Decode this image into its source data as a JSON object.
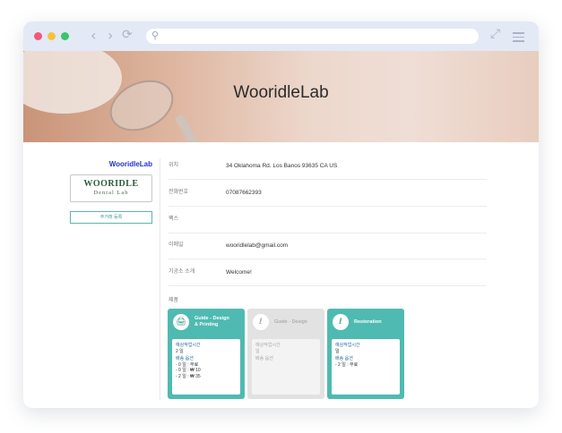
{
  "browser": {
    "back_icon": "‹",
    "forward_icon": "›",
    "reload_icon": "⟳",
    "search_icon": "⚲",
    "expand_icon": "⤢"
  },
  "banner": {
    "title": "WooridleLab"
  },
  "sidebar": {
    "lab_name": "WooridleLab",
    "logo_line1": "WOORIDLE",
    "logo_line2": "Dental Lab",
    "add_button": "주거래 등록"
  },
  "info": [
    {
      "label": "위치",
      "value": "34 Oklahoma Rd. Los Banos 93635 CA US"
    },
    {
      "label": "전화번호",
      "value": "07087662393"
    },
    {
      "label": "팩스",
      "value": ""
    },
    {
      "label": "이메일",
      "value": "wooridlelab@gmail.com"
    },
    {
      "label": "기공소 소개",
      "value": "Welcome!"
    }
  ],
  "products_label": "제품",
  "cards": [
    {
      "icon": "🖨",
      "title1": "Guide - Design",
      "title2": "& Printing",
      "time_label": "예상작업시간",
      "time_value": "2 일",
      "ship_label": "배송 옵션",
      "ship_lines": [
        "- 0 일 : 무료",
        "- 0 일 : ₩ 10",
        "- 2 일 : ₩ 35"
      ]
    },
    {
      "icon": "ℓ",
      "title1": "Guide - Design",
      "title2": "",
      "time_label": "예상작업시간",
      "time_value": "일",
      "ship_label": "배송 옵션",
      "ship_lines": []
    },
    {
      "icon": "ℓ",
      "title1": "Restoration",
      "title2": "",
      "time_label": "예상작업시간",
      "time_value": "일",
      "ship_label": "배송 옵션",
      "ship_lines": [
        "- 2 일 : 무료"
      ]
    }
  ]
}
